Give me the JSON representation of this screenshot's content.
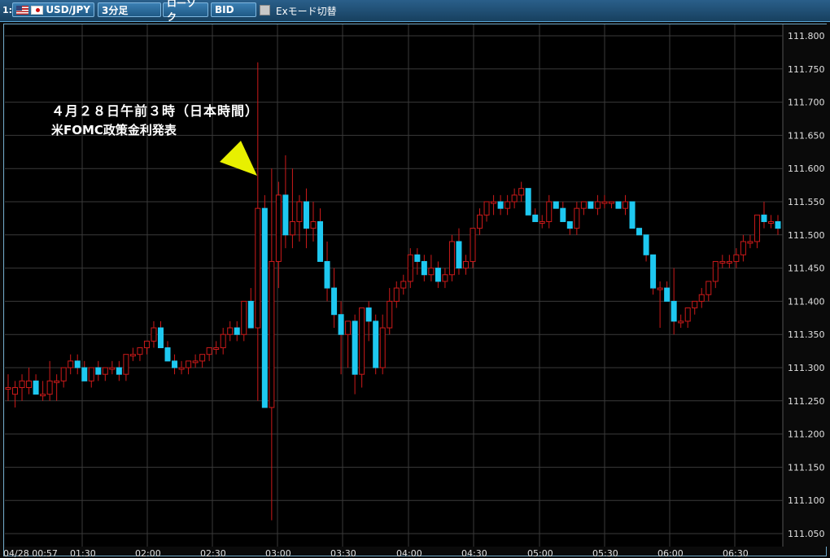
{
  "toolbar": {
    "panel_number": "1:",
    "symbol": "USD/JPY",
    "timeframe": "3分足",
    "chart_type": "ローソク",
    "price_type": "BID",
    "ex_mode_label": "Exモード切替",
    "icons": [
      "us-flag-icon",
      "jp-flag-icon",
      "checkbox-icon"
    ]
  },
  "annotation": {
    "line1": "４月２８日午前３時（日本時間）",
    "line2": "米FOMC政策金利発表",
    "arrow_color": "#e8f000",
    "arrow_icon": "arrow-pointer-icon"
  },
  "colors": {
    "up": "#cc1a1a",
    "down": "#1ec8f0",
    "grid": "#3a3a3a",
    "background": "#000000"
  },
  "chart_data": {
    "type": "candlestick",
    "ylim": [
      111.03,
      111.83
    ],
    "y_ticks": [
      "111.800",
      "111.750",
      "111.700",
      "111.650",
      "111.600",
      "111.550",
      "111.500",
      "111.450",
      "111.400",
      "111.350",
      "111.300",
      "111.250",
      "111.200",
      "111.150",
      "111.100",
      "111.050"
    ],
    "x_ticks": [
      "04/28 00:57",
      "01:30",
      "02:00",
      "02:30",
      "03:00",
      "03:30",
      "04:00",
      "04:30",
      "05:00",
      "05:30",
      "06:00",
      "06:30"
    ],
    "candles": [
      [
        111.27,
        111.29,
        111.25,
        111.27
      ],
      [
        111.26,
        111.28,
        111.24,
        111.27
      ],
      [
        111.27,
        111.29,
        111.25,
        111.28
      ],
      [
        111.27,
        111.3,
        111.26,
        111.28
      ],
      [
        111.28,
        111.29,
        111.26,
        111.26
      ],
      [
        111.26,
        111.28,
        111.25,
        111.26
      ],
      [
        111.26,
        111.31,
        111.25,
        111.28
      ],
      [
        111.28,
        111.29,
        111.25,
        111.28
      ],
      [
        111.28,
        111.3,
        111.27,
        111.3
      ],
      [
        111.3,
        111.32,
        111.29,
        111.31
      ],
      [
        111.31,
        111.32,
        111.29,
        111.3
      ],
      [
        111.3,
        111.31,
        111.28,
        111.28
      ],
      [
        111.28,
        111.3,
        111.27,
        111.3
      ],
      [
        111.3,
        111.31,
        111.28,
        111.29
      ],
      [
        111.29,
        111.3,
        111.28,
        111.3
      ],
      [
        111.3,
        111.31,
        111.29,
        111.3
      ],
      [
        111.3,
        111.31,
        111.28,
        111.29
      ],
      [
        111.29,
        111.32,
        111.28,
        111.32
      ],
      [
        111.32,
        111.33,
        111.31,
        111.32
      ],
      [
        111.32,
        111.33,
        111.31,
        111.33
      ],
      [
        111.33,
        111.34,
        111.32,
        111.34
      ],
      [
        111.34,
        111.37,
        111.33,
        111.36
      ],
      [
        111.36,
        111.37,
        111.33,
        111.33
      ],
      [
        111.33,
        111.34,
        111.31,
        111.31
      ],
      [
        111.31,
        111.32,
        111.29,
        111.3
      ],
      [
        111.3,
        111.31,
        111.29,
        111.3
      ],
      [
        111.3,
        111.31,
        111.29,
        111.31
      ],
      [
        111.31,
        111.32,
        111.3,
        111.31
      ],
      [
        111.31,
        111.32,
        111.3,
        111.32
      ],
      [
        111.32,
        111.33,
        111.31,
        111.33
      ],
      [
        111.33,
        111.34,
        111.32,
        111.33
      ],
      [
        111.33,
        111.36,
        111.32,
        111.35
      ],
      [
        111.35,
        111.37,
        111.34,
        111.36
      ],
      [
        111.36,
        111.37,
        111.34,
        111.35
      ],
      [
        111.35,
        111.4,
        111.34,
        111.4
      ],
      [
        111.4,
        111.42,
        111.36,
        111.36
      ],
      [
        111.36,
        111.76,
        111.25,
        111.54
      ],
      [
        111.54,
        111.56,
        111.24,
        111.24
      ],
      [
        111.24,
        111.6,
        111.07,
        111.46
      ],
      [
        111.46,
        111.58,
        111.42,
        111.56
      ],
      [
        111.56,
        111.62,
        111.48,
        111.5
      ],
      [
        111.5,
        111.6,
        111.48,
        111.52
      ],
      [
        111.52,
        111.56,
        111.49,
        111.55
      ],
      [
        111.55,
        111.57,
        111.48,
        111.51
      ],
      [
        111.51,
        111.55,
        111.49,
        111.52
      ],
      [
        111.52,
        111.54,
        111.46,
        111.46
      ],
      [
        111.46,
        111.49,
        111.4,
        111.42
      ],
      [
        111.42,
        111.45,
        111.36,
        111.38
      ],
      [
        111.38,
        111.4,
        111.29,
        111.35
      ],
      [
        111.35,
        111.37,
        111.3,
        111.37
      ],
      [
        111.37,
        111.38,
        111.26,
        111.29
      ],
      [
        111.29,
        111.37,
        111.27,
        111.39
      ],
      [
        111.39,
        111.4,
        111.34,
        111.37
      ],
      [
        111.37,
        111.38,
        111.29,
        111.3
      ],
      [
        111.3,
        111.38,
        111.29,
        111.36
      ],
      [
        111.36,
        111.42,
        111.35,
        111.4
      ],
      [
        111.4,
        111.43,
        111.39,
        111.42
      ],
      [
        111.42,
        111.44,
        111.41,
        111.43
      ],
      [
        111.43,
        111.48,
        111.42,
        111.47
      ],
      [
        111.47,
        111.48,
        111.44,
        111.46
      ],
      [
        111.46,
        111.47,
        111.43,
        111.44
      ],
      [
        111.44,
        111.47,
        111.43,
        111.45
      ],
      [
        111.45,
        111.46,
        111.42,
        111.43
      ],
      [
        111.43,
        111.45,
        111.42,
        111.44
      ],
      [
        111.44,
        111.5,
        111.43,
        111.49
      ],
      [
        111.49,
        111.51,
        111.44,
        111.45
      ],
      [
        111.45,
        111.47,
        111.44,
        111.46
      ],
      [
        111.46,
        111.51,
        111.45,
        111.51
      ],
      [
        111.51,
        111.54,
        111.5,
        111.53
      ],
      [
        111.53,
        111.55,
        111.52,
        111.55
      ],
      [
        111.55,
        111.56,
        111.53,
        111.55
      ],
      [
        111.55,
        111.56,
        111.53,
        111.54
      ],
      [
        111.54,
        111.56,
        111.53,
        111.55
      ],
      [
        111.55,
        111.57,
        111.54,
        111.56
      ],
      [
        111.56,
        111.58,
        111.55,
        111.57
      ],
      [
        111.57,
        111.57,
        111.53,
        111.53
      ],
      [
        111.53,
        111.54,
        111.52,
        111.52
      ],
      [
        111.52,
        111.53,
        111.51,
        111.52
      ],
      [
        111.52,
        111.56,
        111.51,
        111.55
      ],
      [
        111.55,
        111.55,
        111.54,
        111.54
      ],
      [
        111.54,
        111.55,
        111.52,
        111.52
      ],
      [
        111.52,
        111.52,
        111.5,
        111.51
      ],
      [
        111.51,
        111.55,
        111.5,
        111.54
      ],
      [
        111.54,
        111.55,
        111.53,
        111.55
      ],
      [
        111.55,
        111.55,
        111.54,
        111.54
      ],
      [
        111.54,
        111.56,
        111.53,
        111.55
      ],
      [
        111.55,
        111.56,
        111.54,
        111.55
      ],
      [
        111.55,
        111.55,
        111.54,
        111.55
      ],
      [
        111.55,
        111.55,
        111.54,
        111.54
      ],
      [
        111.54,
        111.56,
        111.53,
        111.55
      ],
      [
        111.55,
        111.55,
        111.51,
        111.51
      ],
      [
        111.51,
        111.51,
        111.5,
        111.5
      ],
      [
        111.5,
        111.5,
        111.46,
        111.47
      ],
      [
        111.47,
        111.47,
        111.41,
        111.42
      ],
      [
        111.42,
        111.43,
        111.36,
        111.42
      ],
      [
        111.42,
        111.43,
        111.4,
        111.4
      ],
      [
        111.4,
        111.45,
        111.35,
        111.37
      ],
      [
        111.37,
        111.38,
        111.36,
        111.37
      ],
      [
        111.37,
        111.39,
        111.36,
        111.39
      ],
      [
        111.39,
        111.4,
        111.38,
        111.4
      ],
      [
        111.4,
        111.42,
        111.39,
        111.41
      ],
      [
        111.41,
        111.43,
        111.4,
        111.43
      ],
      [
        111.43,
        111.46,
        111.42,
        111.46
      ],
      [
        111.46,
        111.47,
        111.45,
        111.46
      ],
      [
        111.46,
        111.47,
        111.45,
        111.46
      ],
      [
        111.46,
        111.48,
        111.45,
        111.47
      ],
      [
        111.47,
        111.5,
        111.46,
        111.49
      ],
      [
        111.49,
        111.5,
        111.48,
        111.49
      ],
      [
        111.49,
        111.53,
        111.48,
        111.53
      ],
      [
        111.53,
        111.55,
        111.51,
        111.52
      ],
      [
        111.52,
        111.53,
        111.51,
        111.52
      ],
      [
        111.52,
        111.53,
        111.5,
        111.51
      ]
    ]
  }
}
